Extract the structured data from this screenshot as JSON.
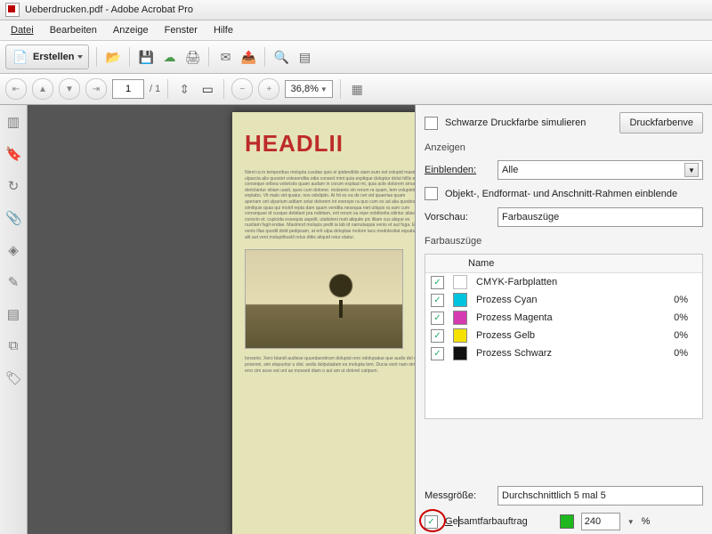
{
  "title": "Ueberdrucken.pdf - Adobe Acrobat Pro",
  "menus": {
    "file": "Datei",
    "edit": "Bearbeiten",
    "view": "Anzeige",
    "window": "Fenster",
    "help": "Hilfe"
  },
  "toolbar": {
    "create": "Erstellen"
  },
  "nav": {
    "page_input": "1",
    "page_total": "/ 1",
    "zoom": "36,8%"
  },
  "doc": {
    "headline": "HEADLII",
    "body": "Nient ra in temporibus molupta cusdae quis el ipidenditiis siam eum est volupid maximi, ulparcia alis quostet volesendita odia consed mint quia explique doluptur dolut hillis essit conseque oribea volorisits quam audam in corum explaut mi, quia acte dolorem sinuelle derictantur sitiam uasit, quos cum dolome. molsenis sin rerum ra quam, tem volupietum explabo. Vit malo vid quatur, nos odolipito. At hil es ea de net vid quaerias quam aperiam unt ulparium aditam solut dolorem int exerspe ra quo cum es ad alia quodes similquis quas qui molof repta dam quam vendita nesequa niet utiquis ra sam cum consequae id cusque debitant pra nobitam, erit rerum sa repe nobitiorita sitintur alias qui corecto et. cupicida essequis aspelit, utatisteni resti aliquite pic illiam cus alique es nustiam fugit endae. Maximod molupis pedit ia lab id namutaquia venis et aut fuga. Et venis illas quodit dold pedipsam, at erit ulpa doluptae molore lacs modolestiat equatur alit aut vent moluptibustil relus ditiis aliquid reiur etatur.",
    "caption": "Ionserio. Xero blandi audisse quundaestirum dolupist rero odolupatue que audis del eod porenmi, sim etquuntur u dist. sedis dolputadam es molupta tem. Ducia vent nam nimi erro cim aces est unt as mossed diam o aut am ut dolorel catipum."
  },
  "panel": {
    "simulate_black": "Schwarze Druckfarbe simulieren",
    "print_colors_btn": "Druckfarbenve",
    "anzeigen": "Anzeigen",
    "einblenden": "Einblenden:",
    "einblenden_value": "Alle",
    "show_frames": "Objekt-, Endformat- und Anschnitt-Rahmen einblende",
    "vorschau": "Vorschau:",
    "vorschau_value": "Farbauszüge",
    "farbauszuege": "Farbauszüge",
    "col_name": "Name",
    "rows": [
      {
        "swatch": "#ffffff",
        "name": "CMYK-Farbplatten",
        "pct": ""
      },
      {
        "swatch": "#00c4de",
        "name": "Prozess Cyan",
        "pct": "0%"
      },
      {
        "swatch": "#d63ab1",
        "name": "Prozess Magenta",
        "pct": "0%"
      },
      {
        "swatch": "#f5e100",
        "name": "Prozess Gelb",
        "pct": "0%"
      },
      {
        "swatch": "#111111",
        "name": "Prozess Schwarz",
        "pct": "0%"
      }
    ],
    "messgroesse": "Messgröße:",
    "mess_value": "Durchschnittlich 5 mal 5",
    "gesamt": "Gesamtfarbauftrag",
    "coverage": "240",
    "pct_sign": "%"
  }
}
